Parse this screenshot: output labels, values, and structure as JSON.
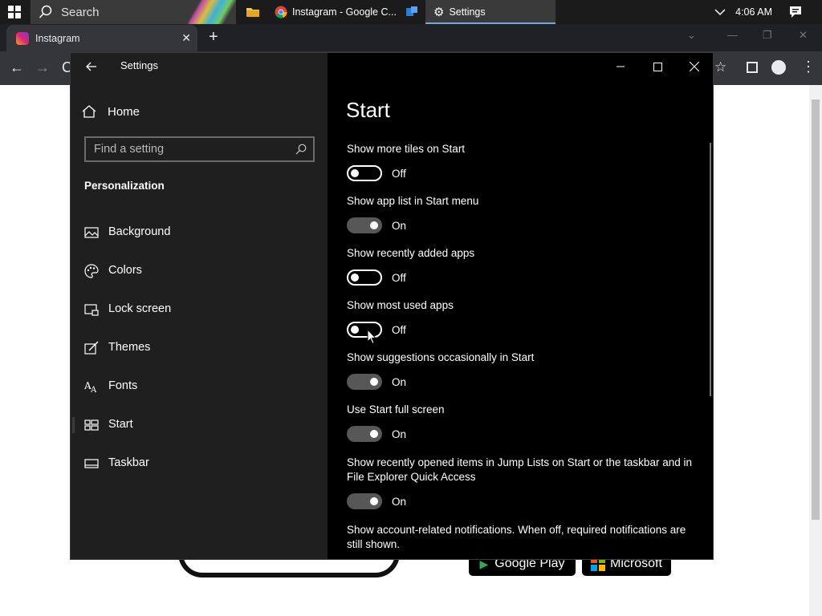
{
  "taskbar": {
    "search_label": "Search",
    "items": [
      {
        "label": "Instagram - Google C..."
      },
      {
        "label": "Settings"
      }
    ],
    "clock": "4:06 AM"
  },
  "browser": {
    "tab_title": "Instagram",
    "store_badges": [
      "Google Play",
      "Microsoft"
    ]
  },
  "settings": {
    "window_title": "Settings",
    "home_label": "Home",
    "search_placeholder": "Find a setting",
    "section_title": "Personalization",
    "nav": [
      {
        "label": "Background",
        "icon": "picture-icon"
      },
      {
        "label": "Colors",
        "icon": "palette-icon"
      },
      {
        "label": "Lock screen",
        "icon": "lock-screen-icon"
      },
      {
        "label": "Themes",
        "icon": "brush-icon"
      },
      {
        "label": "Fonts",
        "icon": "fonts-icon"
      },
      {
        "label": "Start",
        "icon": "start-icon",
        "selected": true
      },
      {
        "label": "Taskbar",
        "icon": "taskbar-icon"
      }
    ],
    "page_title": "Start",
    "options": [
      {
        "name": "Show more tiles on Start",
        "state": "Off"
      },
      {
        "name": "Show app list in Start menu",
        "state": "On"
      },
      {
        "name": "Show recently added apps",
        "state": "Off"
      },
      {
        "name": "Show most used apps",
        "state": "Off"
      },
      {
        "name": "Show suggestions occasionally in Start",
        "state": "On"
      },
      {
        "name": "Use Start full screen",
        "state": "On"
      },
      {
        "name": "Show recently opened items in Jump Lists on Start or the taskbar and in File Explorer Quick Access",
        "state": "On"
      },
      {
        "name": "Show account-related notifications. When off, required notifications are still shown.",
        "state": ""
      }
    ]
  },
  "colors": {
    "taskbar_bg": "#1b1b1b",
    "sidebar_bg": "#1f1f1f",
    "main_bg": "#000000",
    "toggle_on": "#575757"
  }
}
